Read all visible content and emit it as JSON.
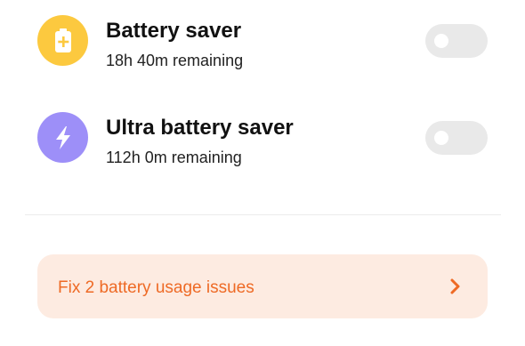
{
  "colors": {
    "saver_icon_bg": "#fcc93f",
    "ultra_icon_bg": "#9d8ff8",
    "toggle_off_bg": "#e9e9e9",
    "issues_bg": "#fdebe1",
    "issues_accent": "#ee6a25",
    "divider": "#ececec"
  },
  "battery_saver": {
    "icon": "battery-plus-icon",
    "title": "Battery saver",
    "subtitle": "18h 40m remaining",
    "enabled": false
  },
  "ultra_battery_saver": {
    "icon": "lightning-bolt-icon",
    "title": "Ultra battery saver",
    "subtitle": "112h 0m remaining",
    "enabled": false
  },
  "issues": {
    "label": "Fix 2 battery usage issues",
    "icon": "chevron-right-icon"
  }
}
